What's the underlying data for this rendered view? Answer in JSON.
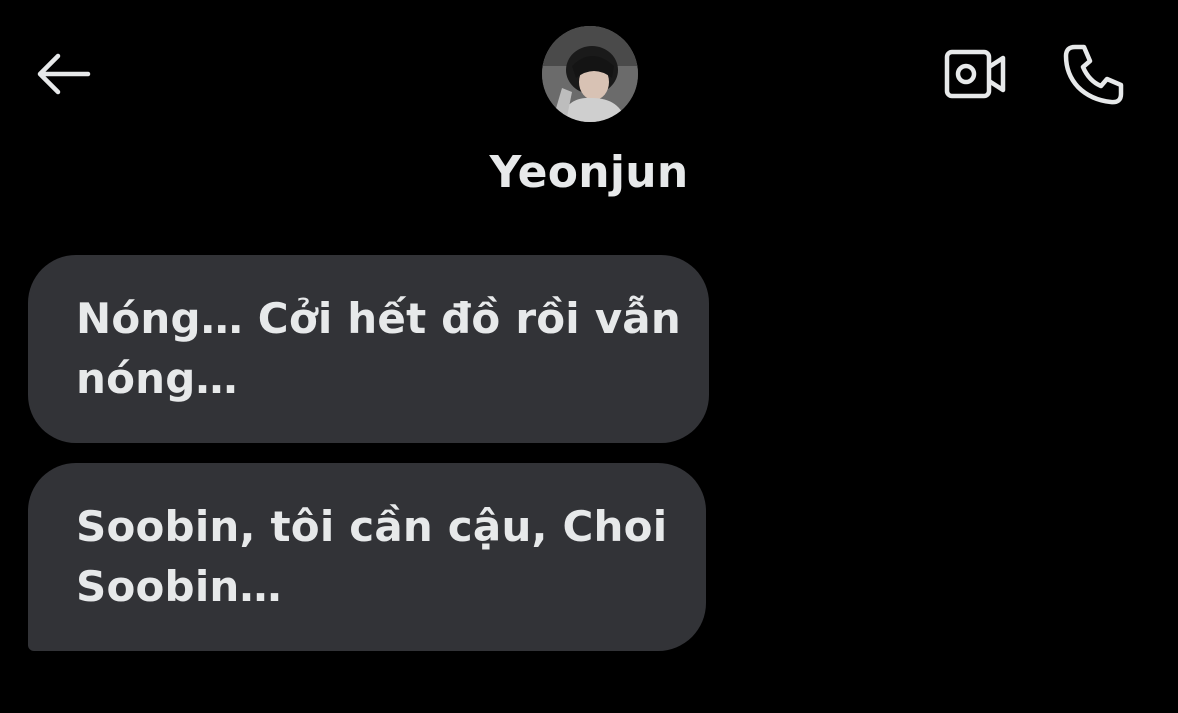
{
  "header": {
    "back_icon": "arrow-left-icon",
    "avatar_alt": "Yeonjun",
    "contact_name": "Yeonjun",
    "video_icon": "video-camera-icon",
    "call_icon": "phone-icon"
  },
  "messages": [
    {
      "lines": [
        "Nóng… Cởi hết đồ rồi vẫn",
        "nóng…"
      ]
    },
    {
      "lines": [
        "Soobin, tôi cần cậu, Choi",
        "Soobin…"
      ]
    }
  ],
  "colors": {
    "background": "#000000",
    "bubble": "#323337",
    "text": "#e7e9ea"
  }
}
